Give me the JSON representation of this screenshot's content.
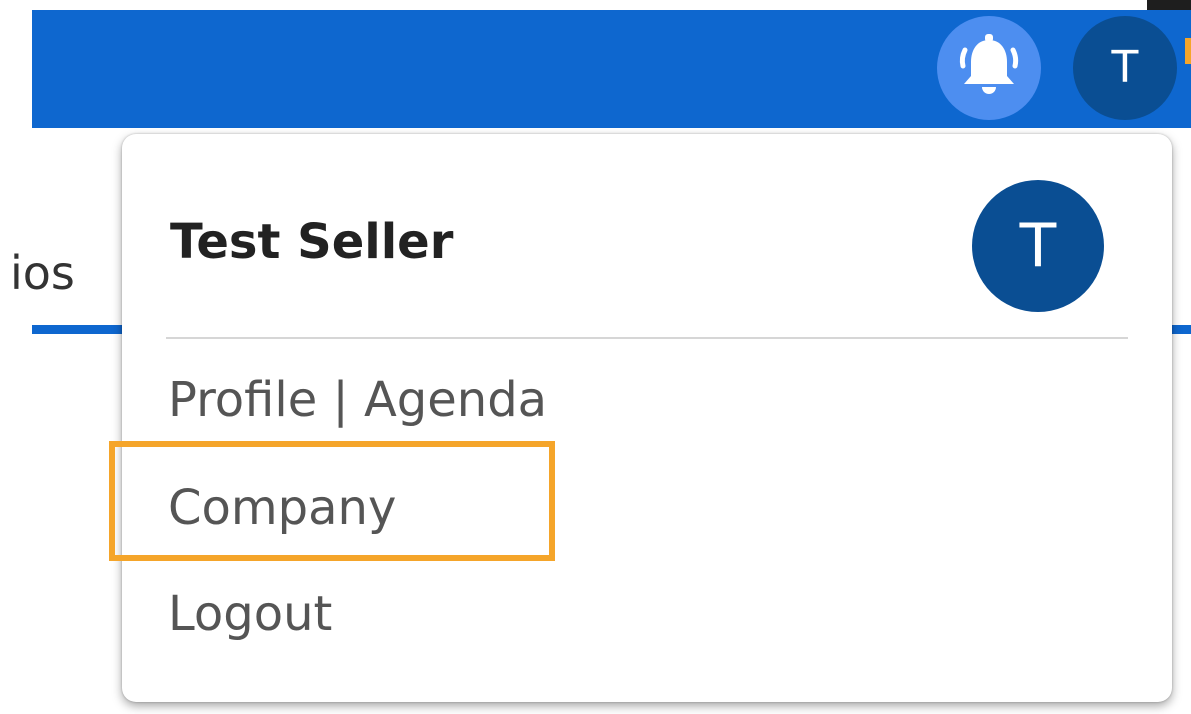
{
  "header": {
    "notifications_icon": "bell-icon",
    "avatar_initial": "T",
    "accent_color": "#0e67cf"
  },
  "background": {
    "tab_partial_label": "ios"
  },
  "user_menu": {
    "user_name": "Test Seller",
    "avatar_initial": "T",
    "items": [
      {
        "label": "Profile | Agenda"
      },
      {
        "label": "Company",
        "highlighted": true
      },
      {
        "label": "Logout"
      }
    ],
    "highlight_color": "#f5a52a"
  }
}
